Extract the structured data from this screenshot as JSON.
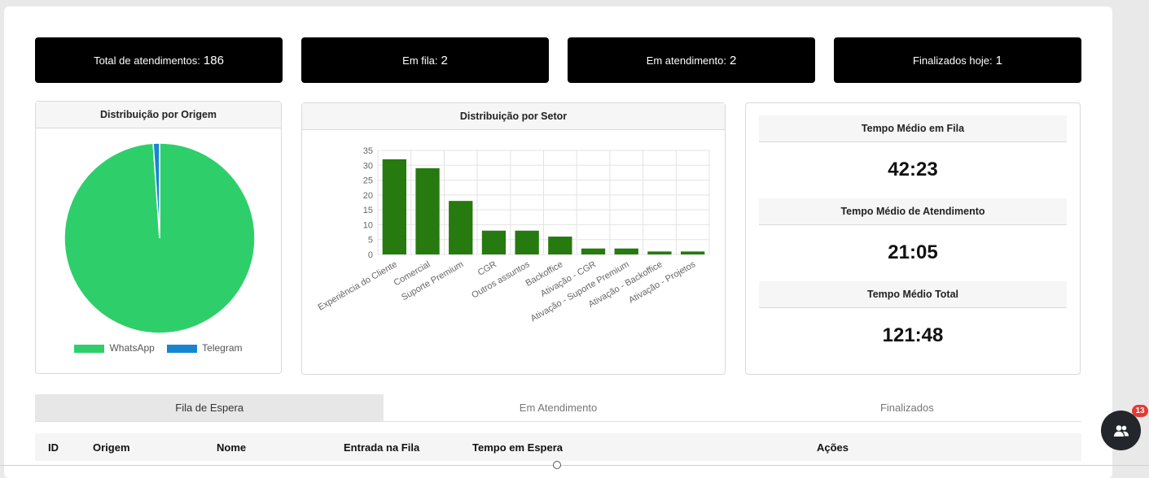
{
  "stats": [
    {
      "label": "Total de atendimentos:",
      "value": "186"
    },
    {
      "label": "Em fila:",
      "value": "2"
    },
    {
      "label": "Em atendimento:",
      "value": "2"
    },
    {
      "label": "Finalizados hoje:",
      "value": "1"
    }
  ],
  "origin_card": {
    "title": "Distribuição por Origem",
    "legend": [
      "WhatsApp",
      "Telegram"
    ]
  },
  "sector_card": {
    "title": "Distribuição por Setor"
  },
  "metrics": [
    {
      "title": "Tempo Médio em Fila",
      "value": "42:23"
    },
    {
      "title": "Tempo Médio de Atendimento",
      "value": "21:05"
    },
    {
      "title": "Tempo Médio Total",
      "value": "121:48"
    }
  ],
  "tabs": [
    "Fila de Espera",
    "Em Atendimento",
    "Finalizados"
  ],
  "table": {
    "columns": [
      "ID",
      "Origem",
      "Nome",
      "Entrada na Fila",
      "Tempo em Espera",
      "Ações"
    ]
  },
  "notification_badge": "13",
  "colors": {
    "whatsapp": "#2ecf6a",
    "telegram": "#1786d0",
    "bar": "#267a0f"
  },
  "chart_data": [
    {
      "type": "pie",
      "title": "Distribuição por Origem",
      "categories": [
        "WhatsApp",
        "Telegram"
      ],
      "values": [
        184,
        2
      ],
      "colors": [
        "#2ecf6a",
        "#1786d0"
      ],
      "legend": "bottom"
    },
    {
      "type": "bar",
      "title": "Distribuição por Setor",
      "categories": [
        "Experiência do Cliente",
        "Comercial",
        "Suporte Premium",
        "CGR",
        "Outros assuntos",
        "Backoffice",
        "Ativação - CGR",
        "Ativação - Suporte Premium",
        "Ativação - Backoffice",
        "Ativação - Projetos"
      ],
      "values": [
        32,
        29,
        18,
        8,
        8,
        6,
        2,
        2,
        1,
        1
      ],
      "ylim": [
        0,
        35
      ],
      "yticks": [
        0,
        5,
        10,
        15,
        20,
        25,
        30,
        35
      ],
      "grid": true,
      "color": "#267a0f"
    }
  ]
}
